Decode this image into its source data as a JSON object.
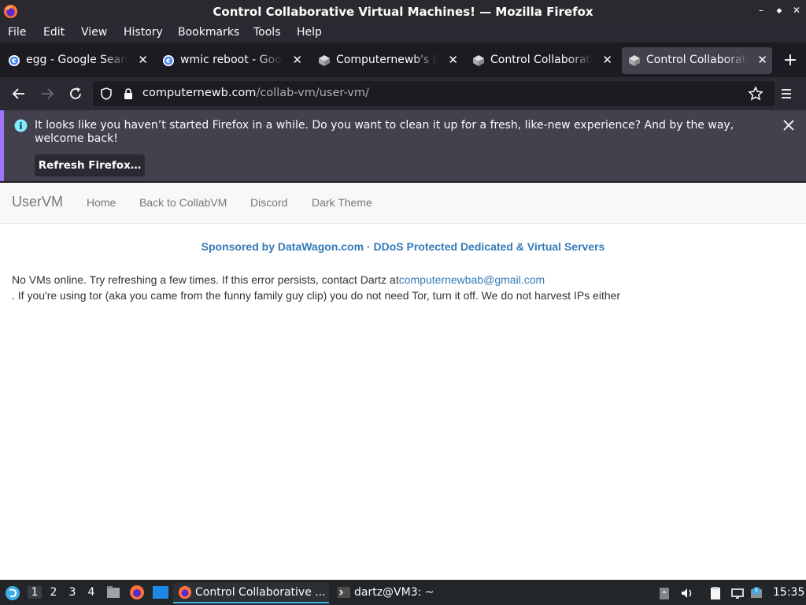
{
  "window": {
    "title": "Control Collaborative Virtual Machines! — Mozilla Firefox",
    "controls": [
      "–",
      "◆",
      "✕"
    ]
  },
  "menu": [
    "File",
    "Edit",
    "View",
    "History",
    "Bookmarks",
    "Tools",
    "Help"
  ],
  "tabs": [
    {
      "label": "egg - Google Search",
      "icon": "google-icon"
    },
    {
      "label": "wmic reboot - Google",
      "icon": "google-icon"
    },
    {
      "label": "Computernewb's Internet",
      "icon": "collabvm-icon"
    },
    {
      "label": "Control Collaborative",
      "icon": "collabvm-icon"
    },
    {
      "label": "Control Collaborative",
      "icon": "collabvm-icon",
      "active": true
    }
  ],
  "urlbar": {
    "domain": "computernewb.com",
    "path": "/collab-vm/user-vm/"
  },
  "notification": {
    "text": "It looks like you haven’t started Firefox in a while. Do you want to clean it up for a fresh, like-new experience? And by the way, welcome back!",
    "button": "Refresh Firefox…"
  },
  "site": {
    "brand": "UserVM",
    "nav": [
      "Home",
      "Back to CollabVM",
      "Discord",
      "Dark Theme"
    ],
    "sponsor": "Sponsored by DataWagon.com · DDoS Protected Dedicated & Virtual Servers",
    "message_pre": "No VMs online. Try refreshing a few times. If this error persists, contact Dartz at",
    "message_email": "computernewbab@gmail.com",
    "message_post": ". If you're using tor (aka you came from the funny family guy clip) you do not need Tor, turn it off. We do not harvest IPs either"
  },
  "taskbar": {
    "workspaces": [
      "1",
      "2",
      "3",
      "4"
    ],
    "tasks": [
      "Control Collaborative ...",
      "dartz@VM3: ~"
    ],
    "clock": "15:35"
  },
  "colors": {
    "link": "#337ab7",
    "notice_accent": "#9f76ff",
    "taskbar_accent": "#3daee9"
  }
}
